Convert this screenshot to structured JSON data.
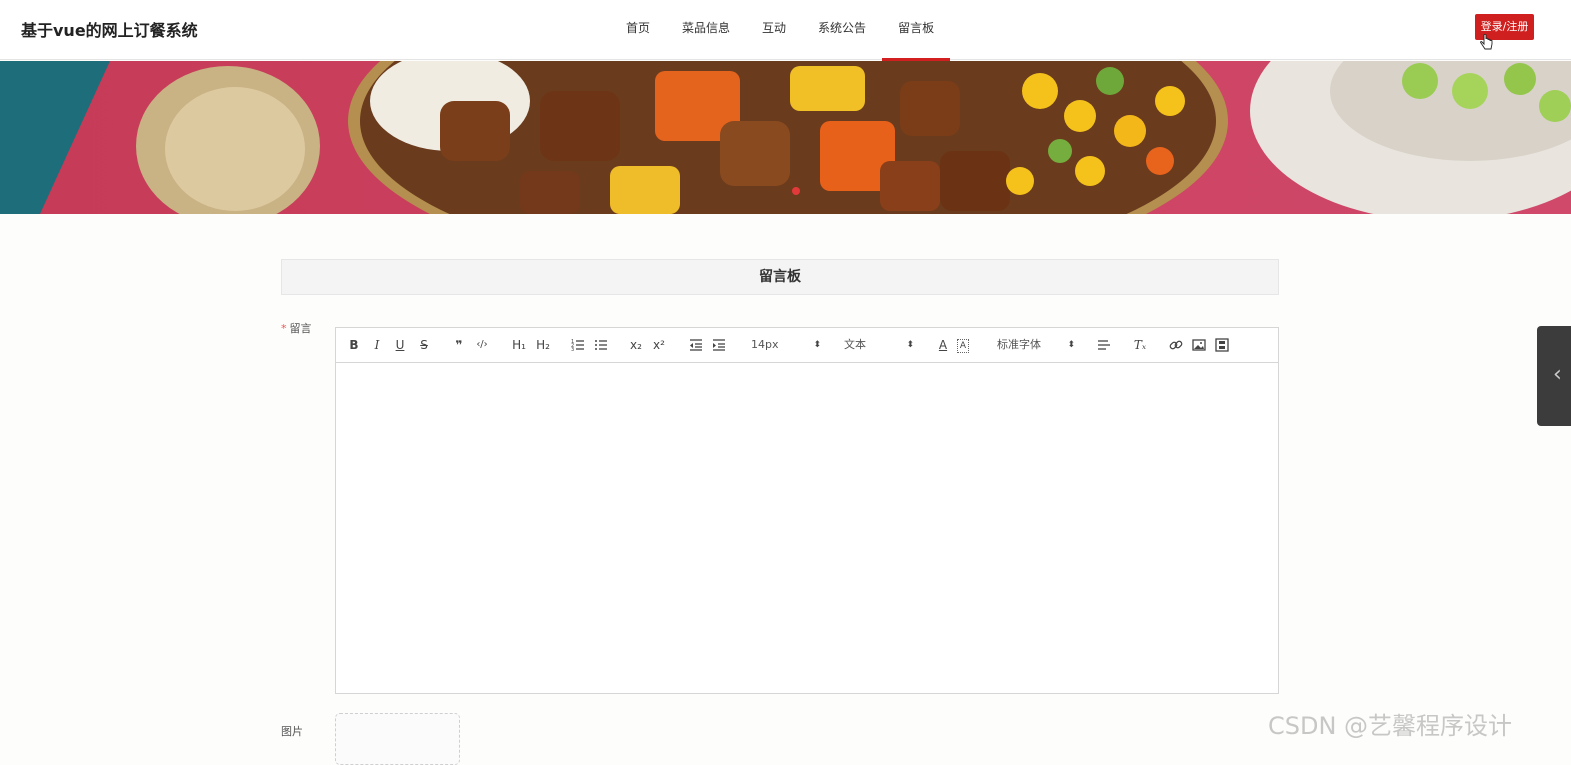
{
  "header": {
    "site_title": "基于vue的网上订餐系统",
    "nav": [
      {
        "label": "首页"
      },
      {
        "label": "菜品信息"
      },
      {
        "label": "互动"
      },
      {
        "label": "系统公告"
      },
      {
        "label": "留言板",
        "active": true
      }
    ],
    "login_label": "登录/注册"
  },
  "section": {
    "title": "留言板"
  },
  "form": {
    "message_label": "留言",
    "required_mark": "*",
    "image_label": "图片"
  },
  "editor": {
    "toolbar": {
      "bold": "B",
      "italic": "I",
      "underline": "U",
      "strike": "S",
      "quote": "❞",
      "code": "‹/›",
      "h1": "H₁",
      "h2": "H₂",
      "subscript": "x₂",
      "superscript": "x²",
      "font_size": "14px",
      "paragraph": "文本",
      "font_family": "标准字体",
      "font_color_glyph": "A",
      "bg_color_glyph": "A",
      "clean": "Tₓ"
    }
  },
  "watermark": "CSDN @艺馨程序设计",
  "colors": {
    "accent": "#d01f1f",
    "side_panel": "#3c3c3c"
  }
}
